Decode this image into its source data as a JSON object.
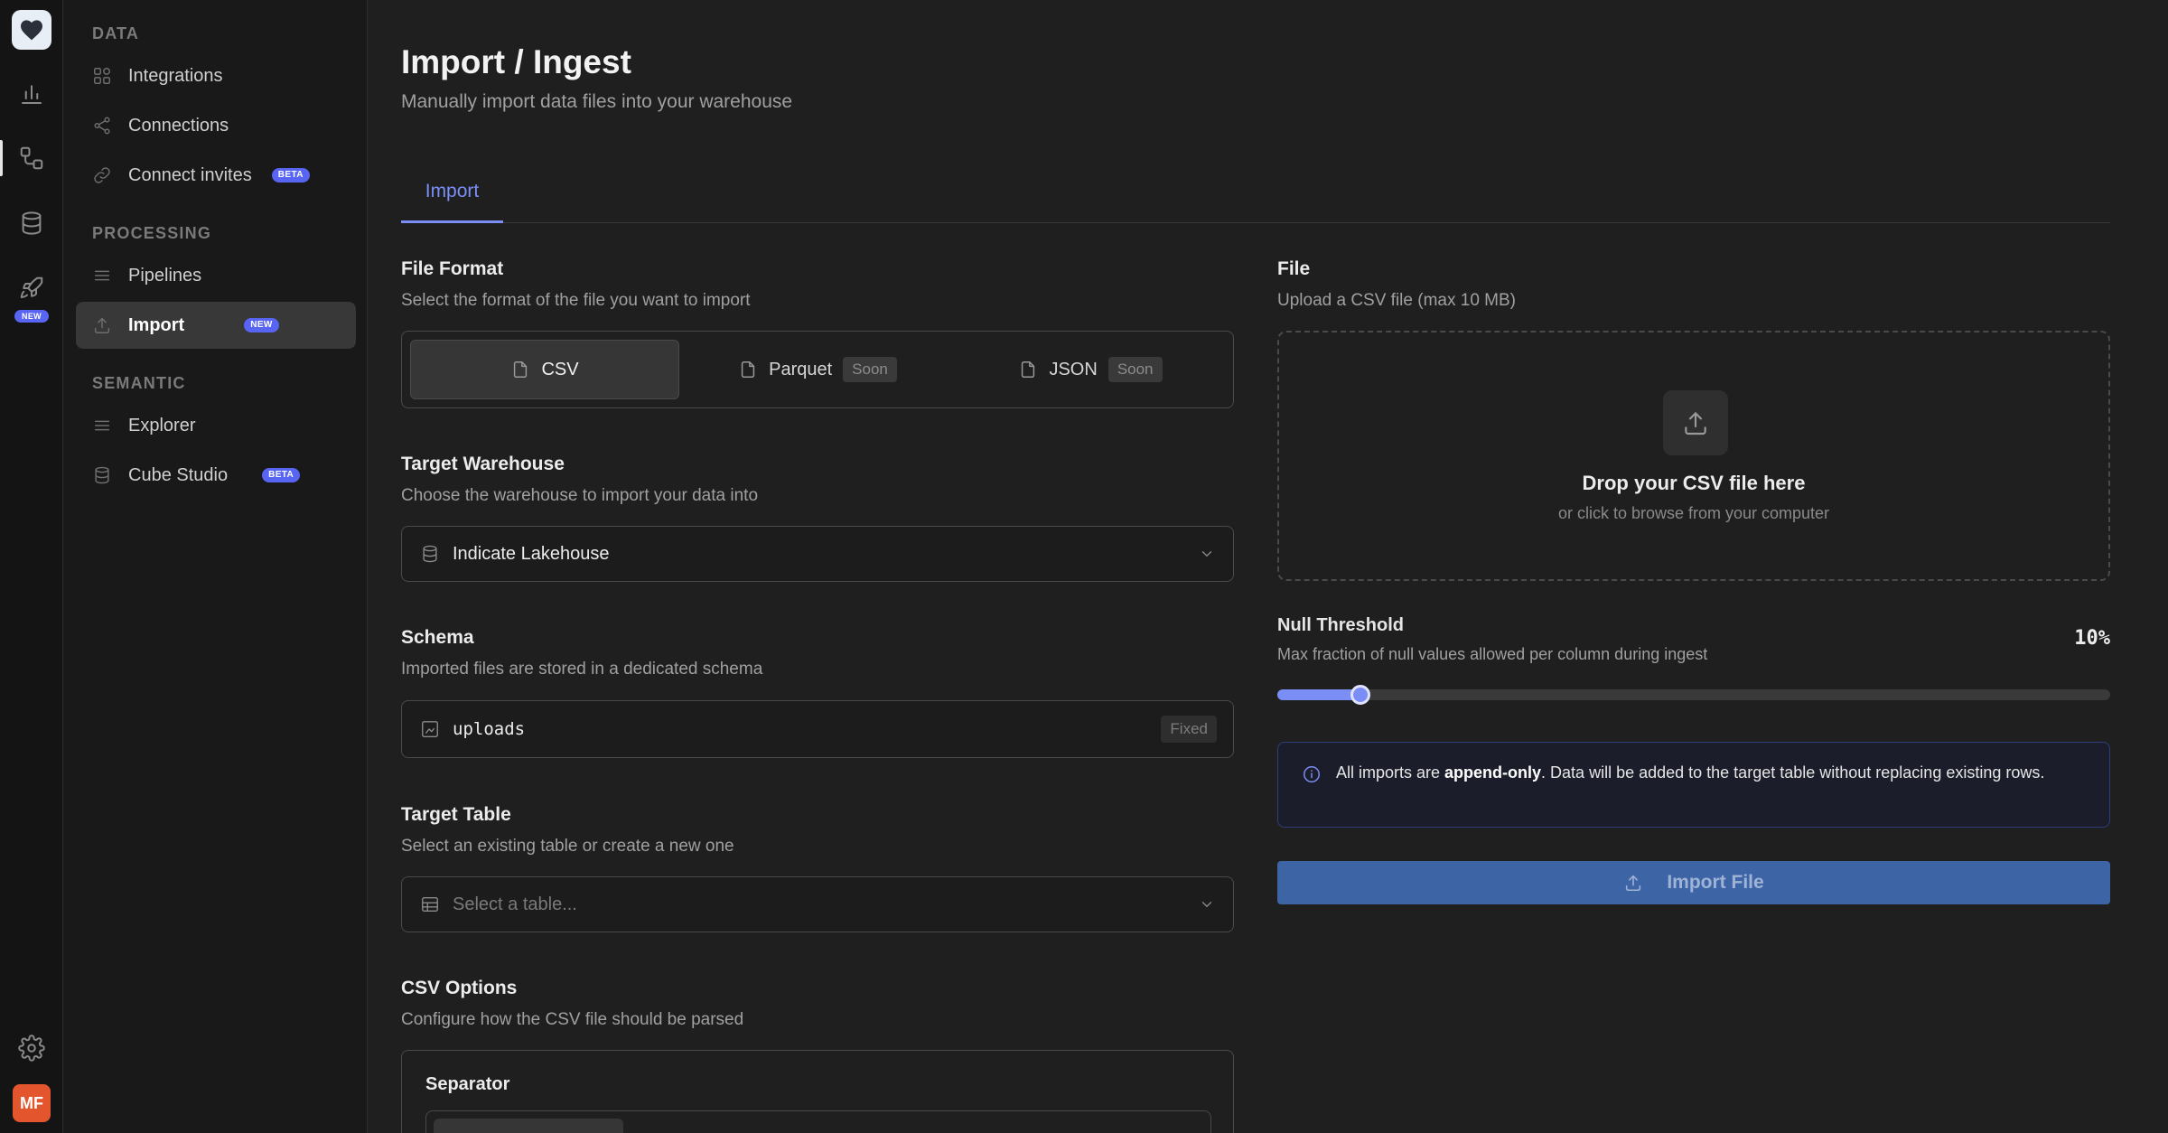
{
  "rail": {
    "items": [
      {
        "icon": "logo-heart-icon"
      },
      {
        "icon": "chart-icon"
      },
      {
        "icon": "data-flow-icon",
        "active": true
      },
      {
        "icon": "database-icon"
      },
      {
        "icon": "rocket-icon",
        "badge": "NEW"
      },
      {
        "icon": "gear-icon"
      }
    ],
    "avatar_initials": "MF",
    "accent": "#5865f2",
    "avatar_color": "#e3562d"
  },
  "sidebar": {
    "sections": [
      {
        "label": "DATA",
        "items": [
          {
            "label": "Integrations",
            "icon": "integrations-icon"
          },
          {
            "label": "Connections",
            "icon": "share-icon"
          },
          {
            "label": "Connect invites",
            "icon": "link-icon",
            "badge": "BETA"
          }
        ]
      },
      {
        "label": "PROCESSING",
        "items": [
          {
            "label": "Pipelines",
            "icon": "list-icon"
          },
          {
            "label": "Import",
            "icon": "upload-icon",
            "badge": "NEW",
            "active": true
          }
        ]
      },
      {
        "label": "SEMANTIC",
        "items": [
          {
            "label": "Explorer",
            "icon": "list-icon"
          },
          {
            "label": "Cube Studio",
            "icon": "database-icon",
            "badge": "BETA"
          }
        ]
      }
    ]
  },
  "header": {
    "title": "Import / Ingest",
    "subtitle": "Manually import data files into your warehouse"
  },
  "tabs": [
    {
      "label": "Import",
      "active": true
    }
  ],
  "file_format": {
    "title": "File Format",
    "description": "Select the format of the file you want to import",
    "options": [
      {
        "label": "CSV",
        "selected": true
      },
      {
        "label": "Parquet",
        "tag": "Soon"
      },
      {
        "label": "JSON",
        "tag": "Soon"
      }
    ]
  },
  "target_warehouse": {
    "title": "Target Warehouse",
    "description": "Choose the warehouse to import your data into",
    "value": "Indicate Lakehouse"
  },
  "schema": {
    "title": "Schema",
    "description": "Imported files are stored in a dedicated schema",
    "value": "uploads",
    "badge": "Fixed"
  },
  "target_table": {
    "title": "Target Table",
    "description": "Select an existing table or create a new one",
    "placeholder": "Select a table..."
  },
  "csv_options": {
    "title": "CSV Options",
    "description": "Configure how the CSV file should be parsed",
    "separator_label": "Separator"
  },
  "file": {
    "title": "File",
    "description": "Upload a CSV file (max 10 MB)",
    "drop_title": "Drop your CSV file here",
    "drop_subtitle": "or click to browse from your computer"
  },
  "null_threshold": {
    "title": "Null Threshold",
    "description": "Max fraction of null values allowed per column during ingest",
    "value_label": "10%",
    "value": 0.1
  },
  "notice": {
    "prefix": "All imports are ",
    "emphasis": "append-only",
    "suffix": ". Data will be added to the target table without replacing existing rows."
  },
  "import_button": {
    "label": "Import File"
  }
}
